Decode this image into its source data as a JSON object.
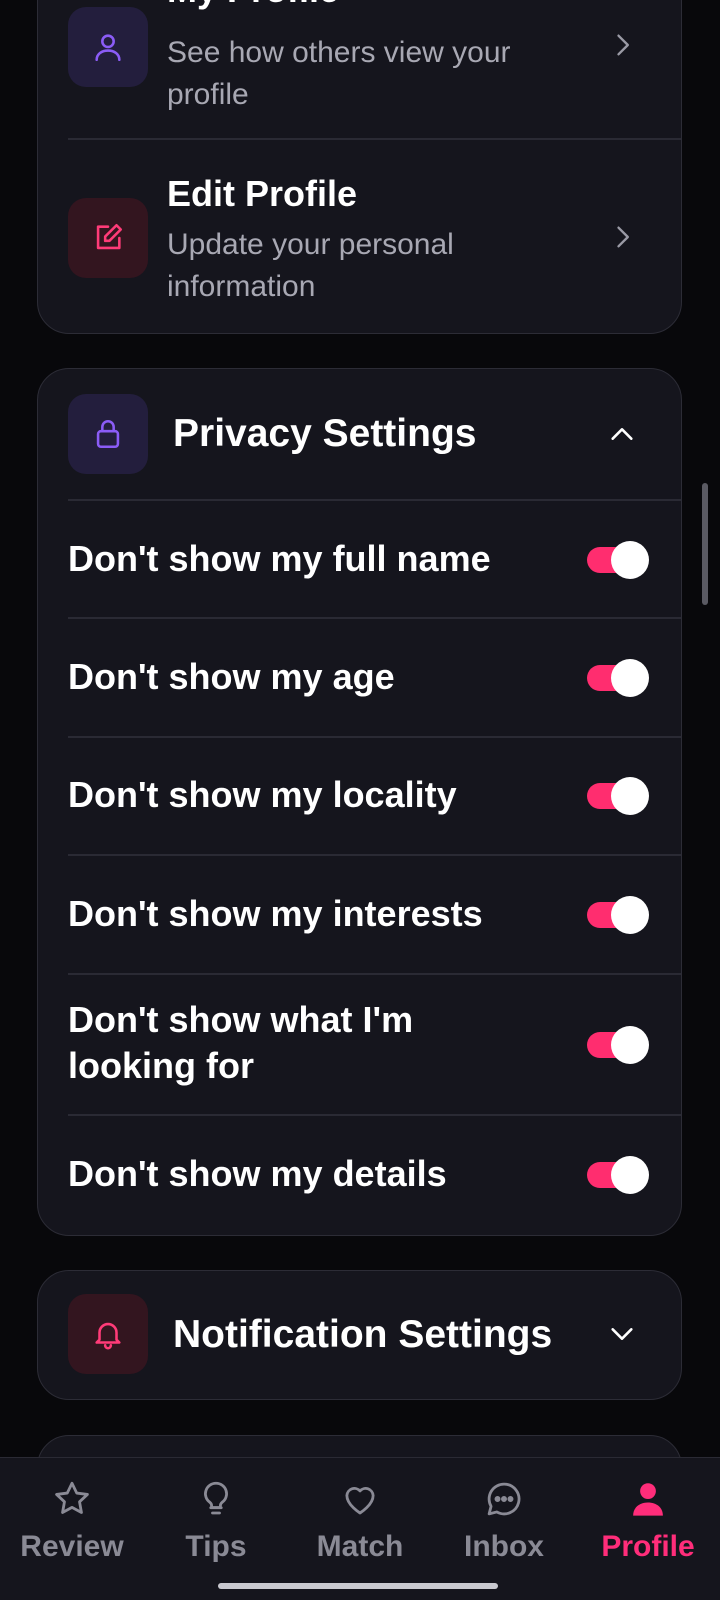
{
  "profile_card": {
    "items": [
      {
        "title": "My Profile",
        "subtitle": "See how others view your profile",
        "icon": "user-icon"
      },
      {
        "title": "Edit Profile",
        "subtitle": "Update your personal information",
        "icon": "edit-icon"
      }
    ]
  },
  "privacy": {
    "title": "Privacy Settings",
    "icon": "lock-icon",
    "expanded": true,
    "settings": [
      {
        "label": "Don't show my full name",
        "enabled": true
      },
      {
        "label": "Don't show my age",
        "enabled": true
      },
      {
        "label": "Don't show my locality",
        "enabled": true
      },
      {
        "label": "Don't show my interests",
        "enabled": true
      },
      {
        "label": "Don't show what I'm looking for",
        "enabled": true
      },
      {
        "label": "Don't show my details",
        "enabled": true
      }
    ]
  },
  "notifications": {
    "title": "Notification Settings",
    "icon": "bell-icon",
    "expanded": false
  },
  "bottom_nav": {
    "items": [
      {
        "label": "Review",
        "icon": "star-icon"
      },
      {
        "label": "Tips",
        "icon": "lightbulb-icon"
      },
      {
        "label": "Match",
        "icon": "heart-icon"
      },
      {
        "label": "Inbox",
        "icon": "chat-icon"
      },
      {
        "label": "Profile",
        "icon": "person-icon"
      }
    ],
    "active": "Profile"
  },
  "colors": {
    "accent": "#ff2d6f",
    "background": "#08080b",
    "card": "#15151d",
    "purple_icon": "#8b5cf6",
    "pink_icon": "#ff3b78"
  }
}
